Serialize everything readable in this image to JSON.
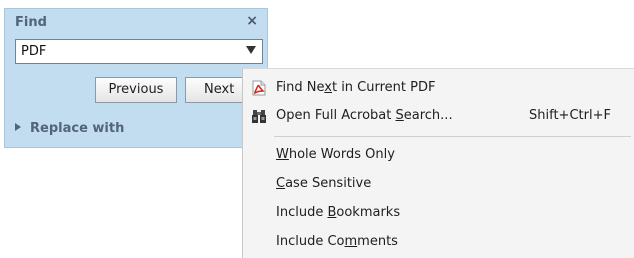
{
  "find_panel": {
    "title": "Find",
    "close_symbol": "×",
    "search": {
      "value": "PDF"
    },
    "buttons": {
      "previous": "Previous",
      "next": "Next"
    },
    "replace_label": "Replace with"
  },
  "menu": {
    "items": [
      {
        "label_parts": [
          "Find Ne",
          "x",
          "t in Current PDF"
        ],
        "icon": "pdf-icon"
      },
      {
        "label_parts": [
          "Open Full Acrobat ",
          "S",
          "earch..."
        ],
        "icon": "binoculars-icon",
        "shortcut": "Shift+Ctrl+F"
      },
      {
        "label_parts": [
          "",
          "W",
          "hole Words Only"
        ]
      },
      {
        "label_parts": [
          "",
          "C",
          "ase Sensitive"
        ]
      },
      {
        "label_parts": [
          "Include ",
          "B",
          "ookmarks"
        ]
      },
      {
        "label_parts": [
          "Include Co",
          "m",
          "ments"
        ]
      }
    ]
  },
  "colors": {
    "panel_bg": "#c2dcf0",
    "menu_bg": "#f4f4f4",
    "pdf_red": "#d9231f"
  }
}
